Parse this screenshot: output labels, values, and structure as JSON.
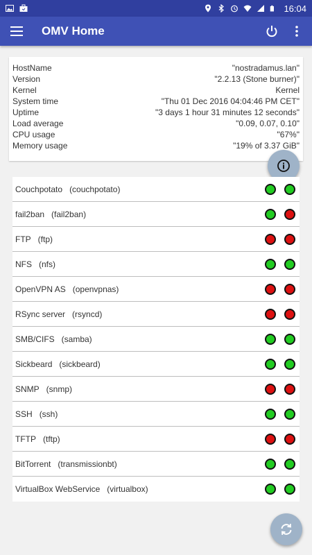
{
  "status_bar": {
    "time": "16:04",
    "left_icons": [
      "image-icon",
      "briefcase-icon"
    ],
    "right_icons": [
      "location-icon",
      "bluetooth-icon",
      "alarm-icon",
      "wifi-icon",
      "signal-icon",
      "battery-icon"
    ]
  },
  "app_bar": {
    "title": "OMV Home",
    "menu_icon": "menu-icon",
    "power_icon": "power-icon",
    "more_icon": "more-vert-icon"
  },
  "system_info": [
    {
      "key": "HostName",
      "value": "\"nostradamus.lan\""
    },
    {
      "key": "Version",
      "value": "\"2.2.13 (Stone burner)\""
    },
    {
      "key": "Kernel",
      "value": "Kernel"
    },
    {
      "key": "System time",
      "value": "\"Thu 01 Dec 2016 04:04:46 PM CET\""
    },
    {
      "key": "Uptime",
      "value": "\"3 days 1 hour 31 minutes 12 seconds\""
    },
    {
      "key": "Load average",
      "value": "\"0.09, 0.07, 0.10\""
    },
    {
      "key": "CPU usage",
      "value": "\"67%\""
    },
    {
      "key": "Memory usage",
      "value": "\"19% of 3.37 GiB\""
    }
  ],
  "colors": {
    "green": "#22cc22",
    "red": "#dd1111",
    "primary": "#3f51b5",
    "primary_dark": "#303f9f",
    "fab": "#9fb3c8"
  },
  "services": [
    {
      "name": "Couchpotato",
      "id": "(couchpotato)",
      "enabled": "green",
      "running": "green"
    },
    {
      "name": "fail2ban",
      "id": "(fail2ban)",
      "enabled": "green",
      "running": "red"
    },
    {
      "name": "FTP",
      "id": "(ftp)",
      "enabled": "red",
      "running": "red"
    },
    {
      "name": "NFS",
      "id": "(nfs)",
      "enabled": "green",
      "running": "green"
    },
    {
      "name": "OpenVPN AS",
      "id": "(openvpnas)",
      "enabled": "red",
      "running": "red"
    },
    {
      "name": "RSync server",
      "id": "(rsyncd)",
      "enabled": "red",
      "running": "red"
    },
    {
      "name": "SMB/CIFS",
      "id": "(samba)",
      "enabled": "green",
      "running": "green"
    },
    {
      "name": "Sickbeard",
      "id": "(sickbeard)",
      "enabled": "green",
      "running": "green"
    },
    {
      "name": "SNMP",
      "id": "(snmp)",
      "enabled": "red",
      "running": "red"
    },
    {
      "name": "SSH",
      "id": "(ssh)",
      "enabled": "green",
      "running": "green"
    },
    {
      "name": "TFTP",
      "id": "(tftp)",
      "enabled": "red",
      "running": "red"
    },
    {
      "name": "BitTorrent",
      "id": "(transmissionbt)",
      "enabled": "green",
      "running": "green"
    },
    {
      "name": "VirtualBox WebService",
      "id": "(virtualbox)",
      "enabled": "green",
      "running": "green"
    }
  ],
  "fabs": {
    "info_icon": "info-icon",
    "refresh_icon": "refresh-icon"
  }
}
